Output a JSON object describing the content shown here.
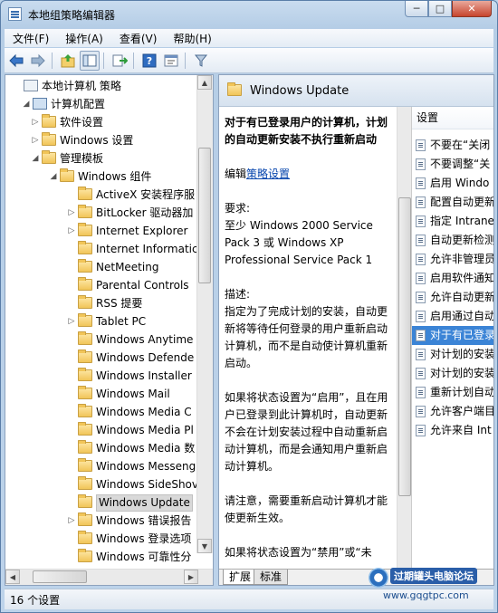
{
  "window": {
    "title": "本地组策略编辑器",
    "controls": {
      "minimize": "─",
      "maximize": "□",
      "close": "✕"
    }
  },
  "menu": [
    "文件(F)",
    "操作(A)",
    "查看(V)",
    "帮助(H)"
  ],
  "toolbar": {
    "icons": [
      "back-icon",
      "forward-icon",
      "up-folder-icon",
      "show-tree-icon",
      "export-icon",
      "help-icon",
      "properties-icon",
      "filter-icon"
    ]
  },
  "tree": [
    {
      "label": "本地计算机 策略",
      "level": 0,
      "icon": "computer-policy-icon",
      "expander": ""
    },
    {
      "label": "计算机配置",
      "level": 1,
      "icon": "computer-icon",
      "expander": "open"
    },
    {
      "label": "软件设置",
      "level": 2,
      "icon": "folder-icon",
      "expander": "closed"
    },
    {
      "label": "Windows 设置",
      "level": 2,
      "icon": "folder-icon",
      "expander": "closed"
    },
    {
      "label": "管理模板",
      "level": 2,
      "icon": "folder-icon",
      "expander": "open"
    },
    {
      "label": "Windows 组件",
      "level": 3,
      "icon": "folder-icon",
      "expander": "open"
    },
    {
      "label": "ActiveX 安装程序服",
      "level": 4,
      "icon": "folder-icon",
      "expander": ""
    },
    {
      "label": "BitLocker 驱动器加",
      "level": 4,
      "icon": "folder-icon",
      "expander": "closed"
    },
    {
      "label": "Internet Explorer",
      "level": 4,
      "icon": "folder-icon",
      "expander": "closed"
    },
    {
      "label": "Internet Informatic",
      "level": 4,
      "icon": "folder-icon",
      "expander": ""
    },
    {
      "label": "NetMeeting",
      "level": 4,
      "icon": "folder-icon",
      "expander": ""
    },
    {
      "label": "Parental Controls",
      "level": 4,
      "icon": "folder-icon",
      "expander": ""
    },
    {
      "label": "RSS 提要",
      "level": 4,
      "icon": "folder-icon",
      "expander": ""
    },
    {
      "label": "Tablet PC",
      "level": 4,
      "icon": "folder-icon",
      "expander": "closed"
    },
    {
      "label": "Windows Anytime",
      "level": 4,
      "icon": "folder-icon",
      "expander": ""
    },
    {
      "label": "Windows Defende",
      "level": 4,
      "icon": "folder-icon",
      "expander": ""
    },
    {
      "label": "Windows Installer",
      "level": 4,
      "icon": "folder-icon",
      "expander": ""
    },
    {
      "label": "Windows Mail",
      "level": 4,
      "icon": "folder-icon",
      "expander": ""
    },
    {
      "label": "Windows Media C",
      "level": 4,
      "icon": "folder-icon",
      "expander": ""
    },
    {
      "label": "Windows Media Pl",
      "level": 4,
      "icon": "folder-icon",
      "expander": ""
    },
    {
      "label": "Windows Media 数",
      "level": 4,
      "icon": "folder-icon",
      "expander": ""
    },
    {
      "label": "Windows Messeng",
      "level": 4,
      "icon": "folder-icon",
      "expander": ""
    },
    {
      "label": "Windows SideShov",
      "level": 4,
      "icon": "folder-icon",
      "expander": ""
    },
    {
      "label": "Windows Update",
      "level": 4,
      "icon": "folder-icon",
      "expander": "",
      "selected": true
    },
    {
      "label": "Windows 错误报告",
      "level": 4,
      "icon": "folder-icon",
      "expander": "closed"
    },
    {
      "label": "Windows 登录选项",
      "level": 4,
      "icon": "folder-icon",
      "expander": ""
    },
    {
      "label": "Windows 可靠性分",
      "level": 4,
      "icon": "folder-icon",
      "expander": ""
    }
  ],
  "right_header": {
    "title": "Windows Update"
  },
  "description": {
    "heading": "对于有已登录用户的计算机，计划的自动更新安装不执行重新启动",
    "edit_prefix": "编辑",
    "edit_link": "策略设置",
    "requirements_label": "要求:",
    "requirements_text": "至少 Windows 2000 Service Pack 3 或 Windows XP Professional Service Pack 1",
    "desc_label": "描述:",
    "desc_text": "指定为了完成计划的安装，自动更新将等待任何登录的用户重新启动计算机，而不是自动使计算机重新启动。",
    "para2": "如果将状态设置为“启用”，且在用户已登录到此计算机时，自动更新不会在计划安装过程中自动重新启动计算机，而是会通知用户重新启动计算机。",
    "para3": "请注意，需要重新启动计算机才能使更新生效。",
    "para4": "如果将状态设置为“禁用”或“未"
  },
  "settings_list": {
    "header": "设置",
    "items": [
      {
        "label": "不要在“关闭",
        "selected": false
      },
      {
        "label": "不要调整“关",
        "selected": false
      },
      {
        "label": "启用 Windo",
        "selected": false
      },
      {
        "label": "配置自动更新",
        "selected": false
      },
      {
        "label": "指定 Intrane",
        "selected": false
      },
      {
        "label": "自动更新检测",
        "selected": false
      },
      {
        "label": "允许非管理员",
        "selected": false
      },
      {
        "label": "启用软件通知",
        "selected": false
      },
      {
        "label": "允许自动更新",
        "selected": false
      },
      {
        "label": "启用通过自动",
        "selected": false
      },
      {
        "label": "对于有已登录",
        "selected": true
      },
      {
        "label": "对计划的安装",
        "selected": false
      },
      {
        "label": "对计划的安装",
        "selected": false
      },
      {
        "label": "重新计划自动",
        "selected": false
      },
      {
        "label": "允许客户端目",
        "selected": false
      },
      {
        "label": "允许来自 Int",
        "selected": false
      }
    ]
  },
  "tabs": [
    "扩展",
    "标准"
  ],
  "status": {
    "text": "16 个设置"
  },
  "watermark": {
    "name": "过期罐头电脑论坛",
    "url": "www.gqgtpc.com"
  }
}
